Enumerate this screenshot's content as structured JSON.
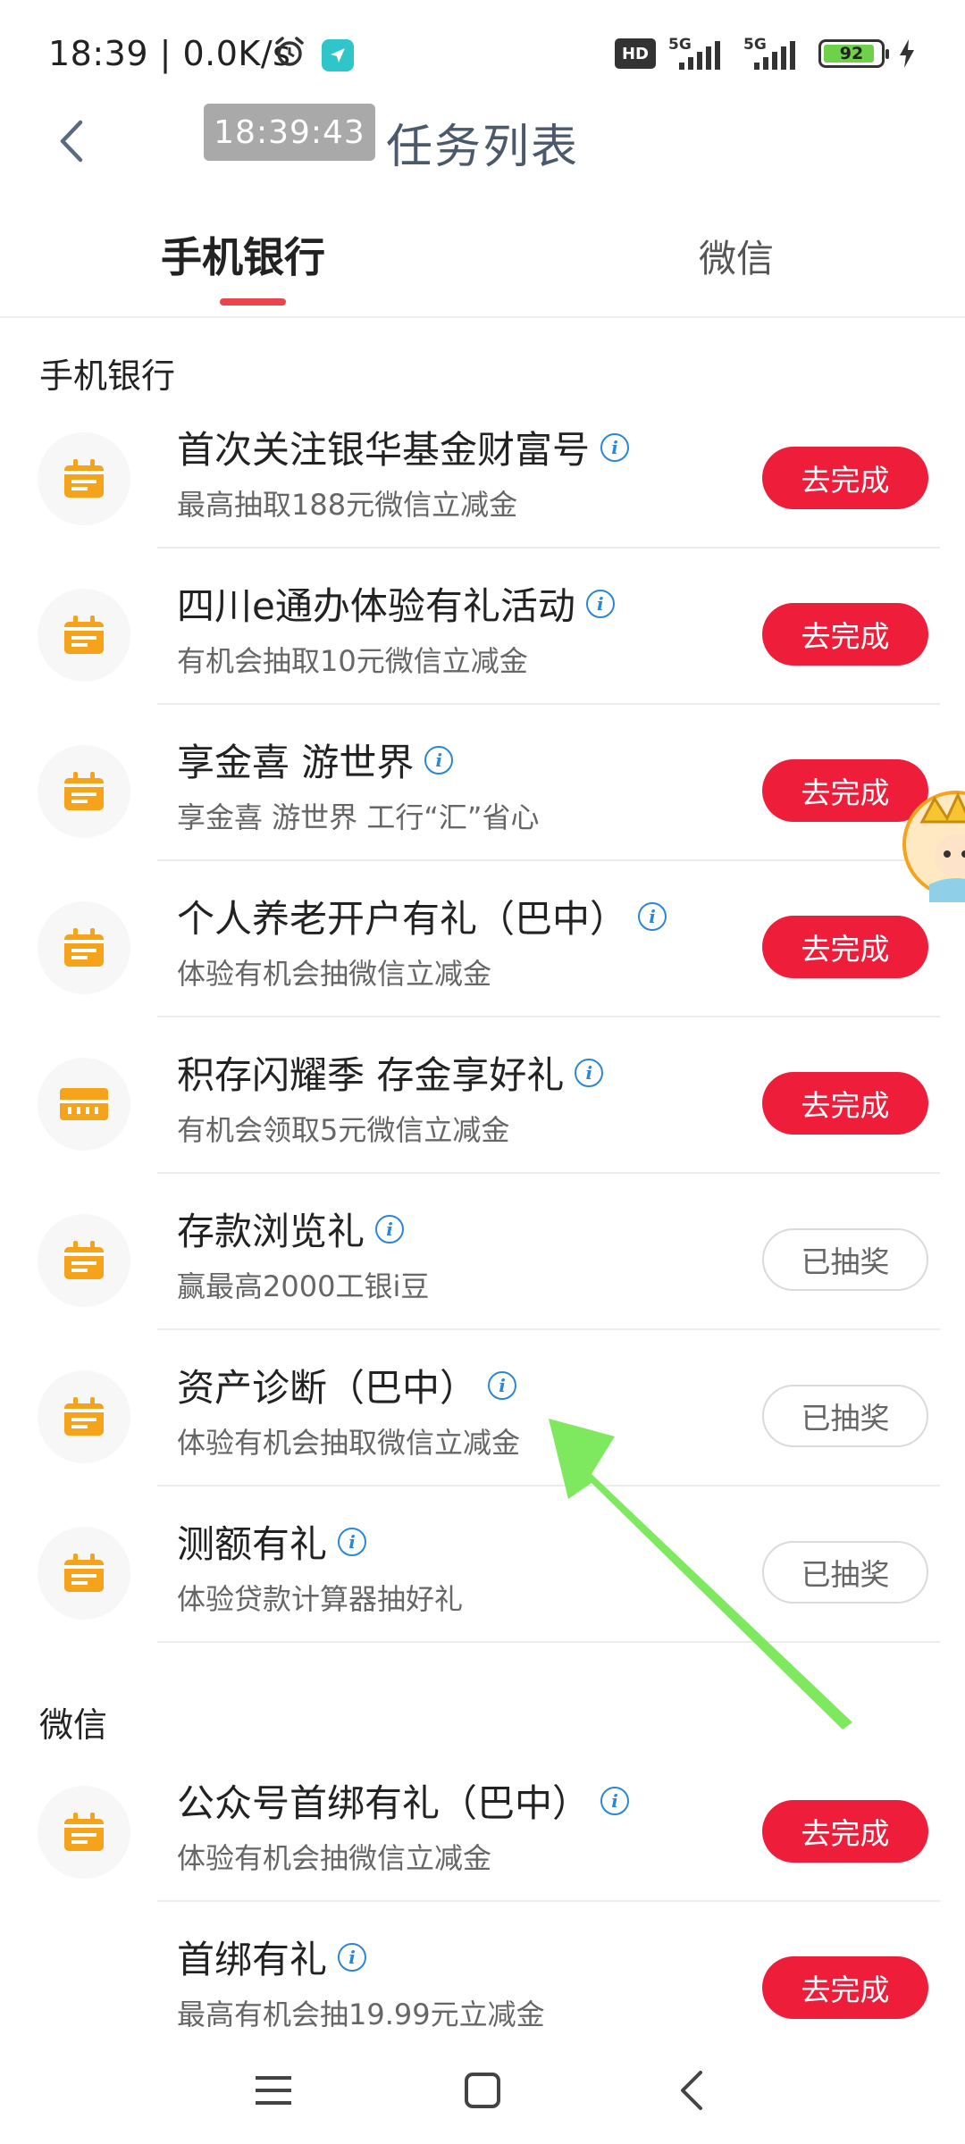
{
  "status_bar": {
    "time": "18:39",
    "speed": "0.0K/s",
    "hd": "HD",
    "signal1": "5G",
    "signal2": "5G",
    "battery": "92"
  },
  "header": {
    "time_overlay": "18:39:43",
    "title": "任务列表"
  },
  "tabs": [
    {
      "label": "手机银行",
      "active": true
    },
    {
      "label": "微信",
      "active": false
    }
  ],
  "sections": [
    {
      "title": "手机银行",
      "tasks": [
        {
          "name": "首次关注银华基金财富号",
          "desc": "最高抽取188元微信立减金",
          "action": "去完成",
          "done": false
        },
        {
          "name": "四川e通办体验有礼活动",
          "desc": "有机会抽取10元微信立减金",
          "action": "去完成",
          "done": false
        },
        {
          "name": "享金喜 游世界",
          "desc": "享金喜 游世界 工行“汇”省心",
          "action": "去完成",
          "done": false
        },
        {
          "name": "个人养老开户有礼（巴中）",
          "desc": "体验有机会抽微信立减金",
          "action": "去完成",
          "done": false
        },
        {
          "name": "积存闪耀季 存金享好礼",
          "desc": "有机会领取5元微信立减金",
          "action": "去完成",
          "done": false
        },
        {
          "name": "存款浏览礼",
          "desc": "赢最高2000工银i豆",
          "action": "已抽奖",
          "done": true
        },
        {
          "name": "资产诊断（巴中）",
          "desc": "体验有机会抽取微信立减金",
          "action": "已抽奖",
          "done": true
        },
        {
          "name": "测额有礼",
          "desc": "体验贷款计算器抽好礼",
          "action": "已抽奖",
          "done": true
        }
      ]
    },
    {
      "title": "微信",
      "tasks": [
        {
          "name": "公众号首绑有礼（巴中）",
          "desc": "体验有机会抽微信立减金",
          "action": "去完成",
          "done": false
        },
        {
          "name": "首绑有礼",
          "desc": "最高有机会抽19.99元立减金",
          "action": "去完成",
          "done": false
        }
      ]
    }
  ],
  "icons": {
    "back": "chevron-left-icon",
    "task": "calendar-icon",
    "info": "info-icon"
  },
  "colors": {
    "accent_red": "#ee1d3a",
    "tab_indicator": "#e8454f",
    "icon_orange": "#f5a31a",
    "info_blue": "#2a87d6",
    "annotation_green": "#7ee85f"
  }
}
